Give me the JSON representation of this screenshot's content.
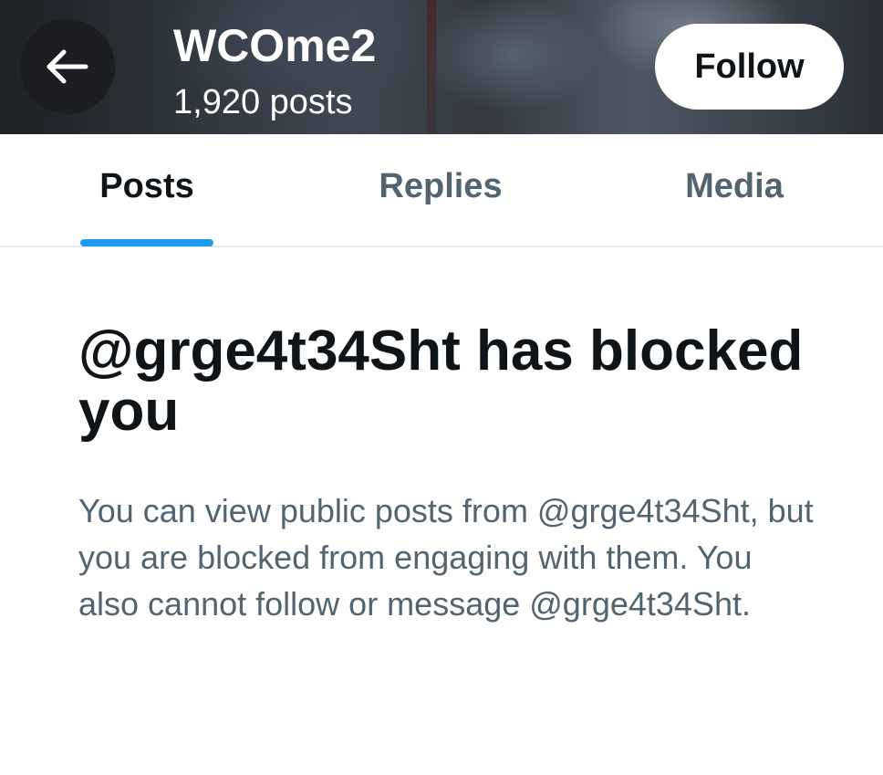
{
  "header": {
    "back_icon": "arrow-left-icon",
    "profile_name": "WCOme2",
    "post_count": "1,920 posts",
    "follow_label": "Follow"
  },
  "tabs": [
    {
      "label": "Posts",
      "active": true
    },
    {
      "label": "Replies",
      "active": false
    },
    {
      "label": "Media",
      "active": false
    }
  ],
  "blocked": {
    "title": "@grge4t34Sht has blocked you",
    "description": "You can view public posts from @grge4t34Sht, but you are blocked from engaging with them. You also cannot follow or message @grge4t34Sht."
  },
  "colors": {
    "accent": "#1d9bf0",
    "text_primary": "#0f1419",
    "text_secondary": "#536471"
  }
}
